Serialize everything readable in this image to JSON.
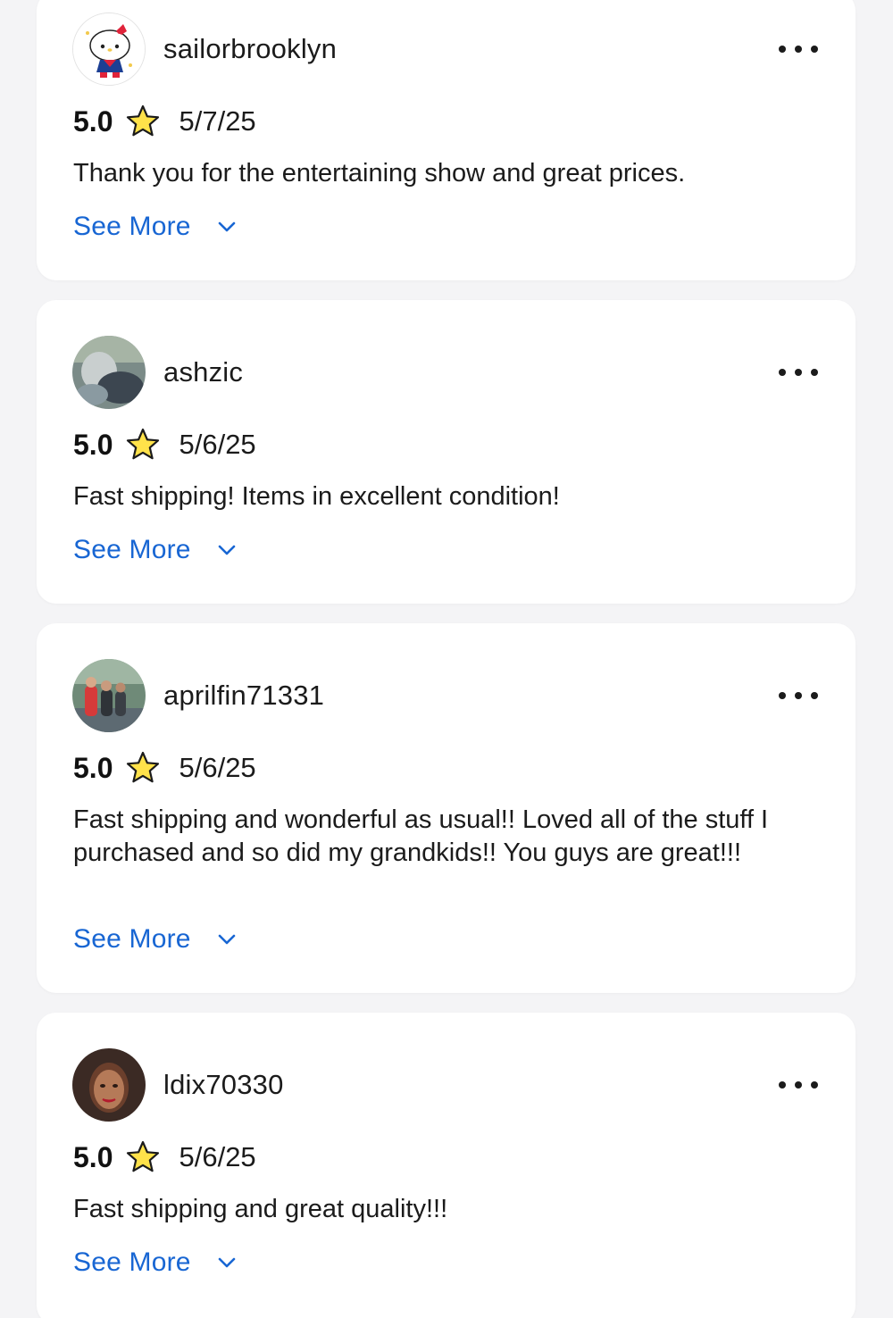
{
  "reviews": [
    {
      "username": "sailorbrooklyn",
      "rating": "5.0",
      "date": "5/7/25",
      "text": "Thank you for the entertaining show and great prices.",
      "see_more": "See More",
      "avatar": "hello-kitty-sailor-avatar"
    },
    {
      "username": "ashzic",
      "rating": "5.0",
      "date": "5/6/25",
      "text": "Fast shipping! Items in excellent condition!",
      "see_more": "See More",
      "avatar": "photo-avatar"
    },
    {
      "username": "aprilfin71331",
      "rating": "5.0",
      "date": "5/6/25",
      "text": "Fast shipping and wonderful as usual!! Loved all of the stuff I purchased and so did my grandkids!! You guys are great!!!",
      "see_more": "See More",
      "avatar": "group-photo-avatar"
    },
    {
      "username": "ldix70330",
      "rating": "5.0",
      "date": "5/6/25",
      "text": "Fast shipping and great quality!!!",
      "see_more": "See More",
      "avatar": "portrait-avatar"
    }
  ],
  "colors": {
    "link": "#1866d3",
    "star_fill": "#ffe24a",
    "star_stroke": "#1b1b1b",
    "card_bg": "#ffffff",
    "page_bg": "#f4f4f6"
  }
}
